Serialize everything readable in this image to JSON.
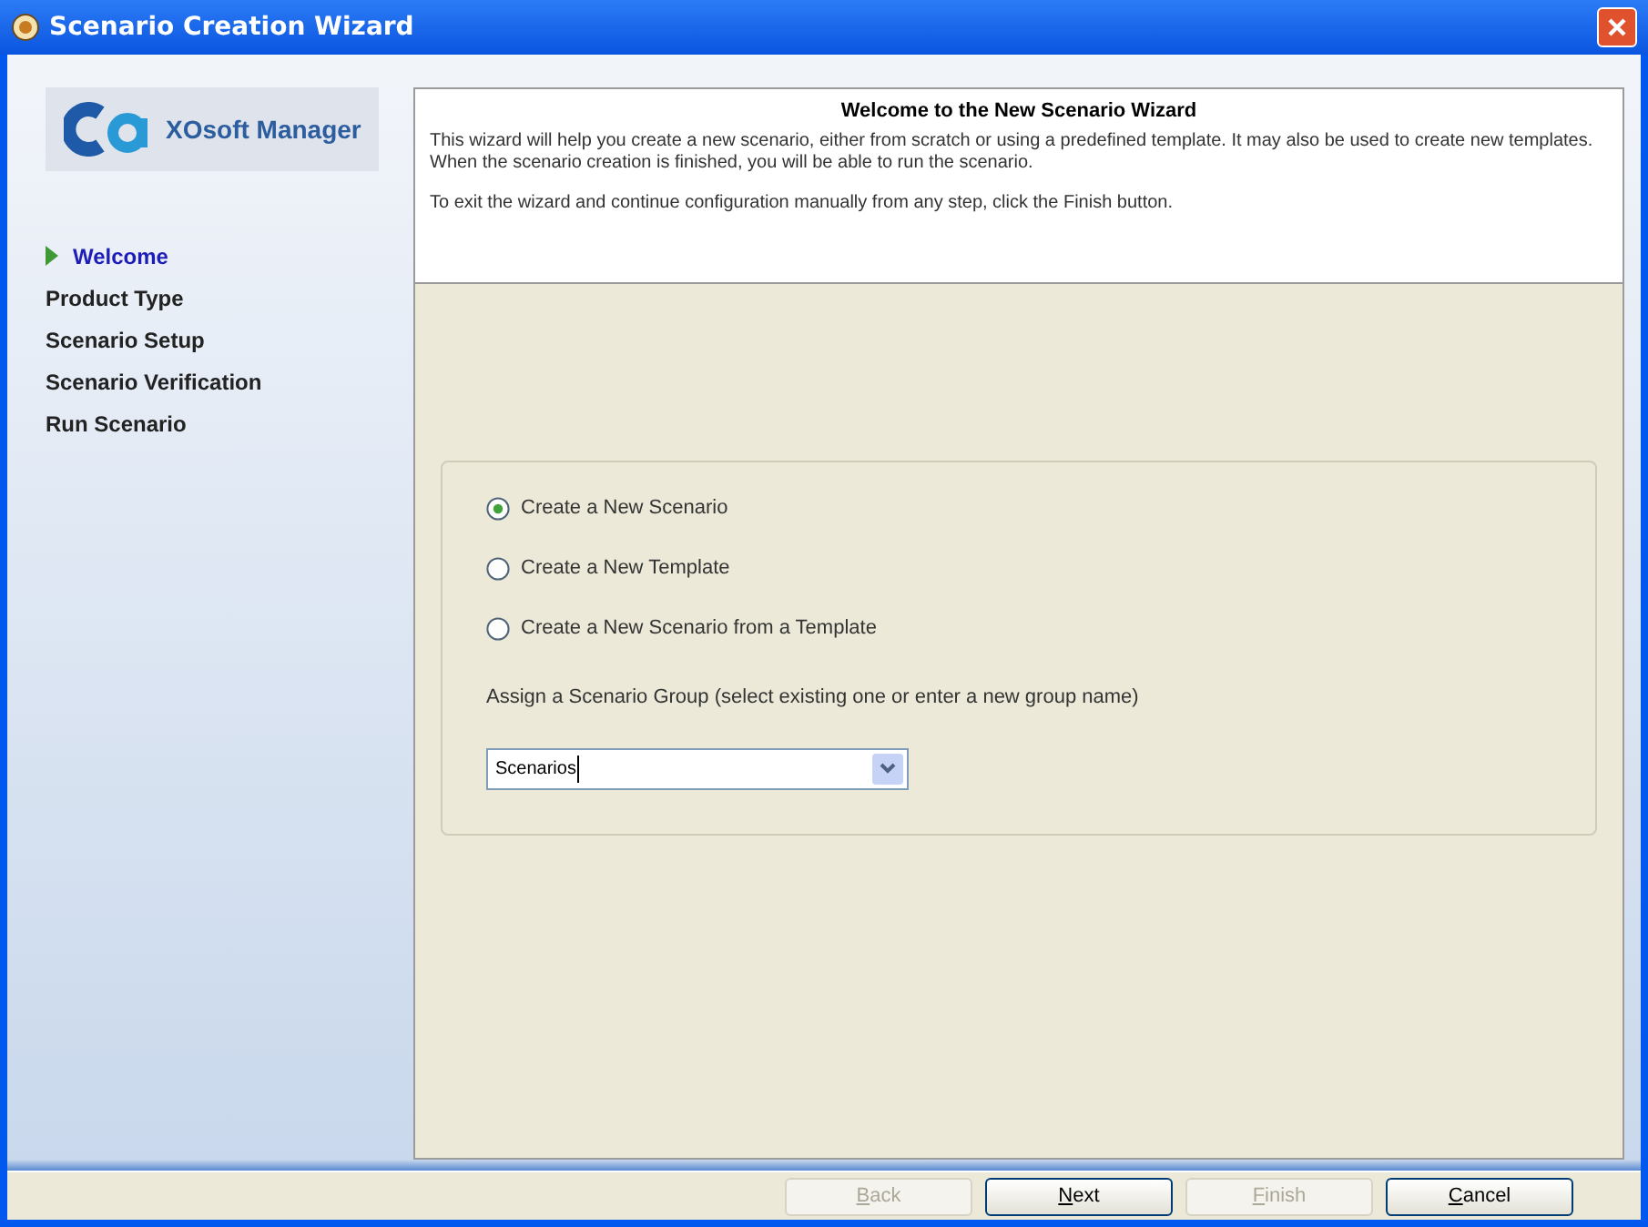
{
  "window": {
    "title": "Scenario Creation Wizard"
  },
  "logo": {
    "text": "XOsoft Manager"
  },
  "steps": [
    {
      "label": "Welcome",
      "selected": true
    },
    {
      "label": "Product Type",
      "selected": false
    },
    {
      "label": "Scenario Setup",
      "selected": false
    },
    {
      "label": "Scenario Verification",
      "selected": false
    },
    {
      "label": "Run Scenario",
      "selected": false
    }
  ],
  "header": {
    "title": "Welcome to the New Scenario Wizard",
    "paragraphs": [
      "This wizard will help you create a new scenario, either from scratch or using a predefined template. It may also be used to create new templates. When the scenario creation is finished, you will be able to run the scenario.",
      "To exit the wizard and continue configuration manually from any step, click the Finish button."
    ]
  },
  "options": [
    {
      "label": "Create a New Scenario",
      "selected": true
    },
    {
      "label": "Create a New Template",
      "selected": false
    },
    {
      "label": "Create a New Scenario from a Template",
      "selected": false
    }
  ],
  "group": {
    "label": "Assign a Scenario Group (select existing one or enter a new group name)",
    "value": "Scenarios"
  },
  "buttons": [
    {
      "label": "Back",
      "disabled": true
    },
    {
      "label": "Next",
      "disabled": false
    },
    {
      "label": "Finish",
      "disabled": true
    },
    {
      "label": "Cancel",
      "disabled": false
    }
  ]
}
